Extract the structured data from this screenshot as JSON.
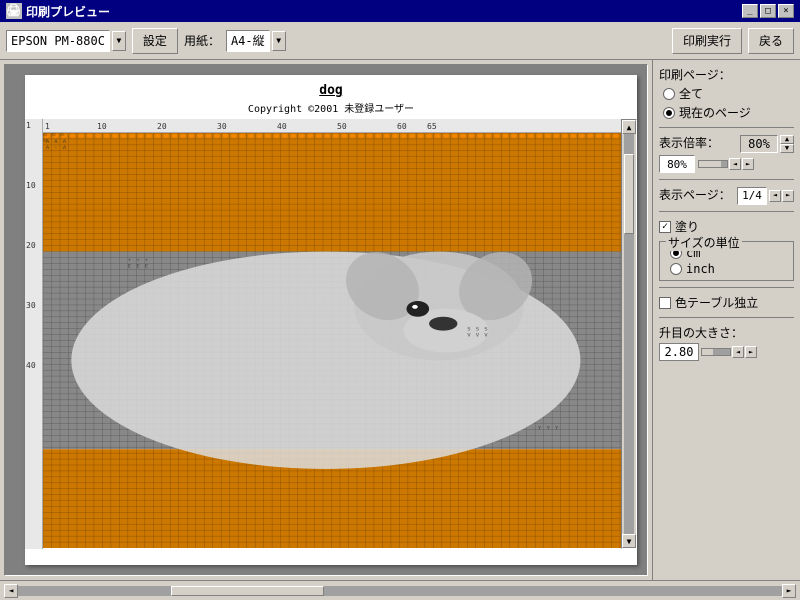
{
  "window": {
    "title": "印刷プレビュー",
    "title_icon": "printer-icon"
  },
  "title_buttons": {
    "minimize": "_",
    "maximize": "□",
    "close": "×"
  },
  "toolbar": {
    "printer_label": "EPSON PM-880C",
    "settings_btn": "設定",
    "paper_label": "用紙：",
    "paper_value": "A4-縦",
    "print_btn": "印刷実行",
    "back_btn": "戻る"
  },
  "preview": {
    "title": "dog",
    "copyright": "Copyright ©2001 未登録ユーザー",
    "ruler_marks_h": [
      "1",
      "10",
      "20",
      "30",
      "40",
      "50",
      "60",
      "65"
    ],
    "ruler_marks_v": [
      "1",
      "10",
      "20",
      "30",
      "40"
    ]
  },
  "right_panel": {
    "print_page_label": "印刷ページ：",
    "all_pages_label": "全て",
    "current_page_label": "現在のページ",
    "current_page_selected": true,
    "zoom_label": "表示倍率：",
    "zoom_value": "80%",
    "zoom_percent": "80%",
    "view_page_label": "表示ページ：",
    "view_page_value": "1/4",
    "fill_label": "塗り",
    "fill_checked": true,
    "size_unit_label": "サイズの単位",
    "cm_label": "cm",
    "cm_selected": true,
    "inch_label": "inch",
    "inch_selected": false,
    "color_table_label": "色テーブル独立",
    "color_table_checked": false,
    "cell_size_label": "升目の大きさ：",
    "cell_size_value": "2.80"
  }
}
